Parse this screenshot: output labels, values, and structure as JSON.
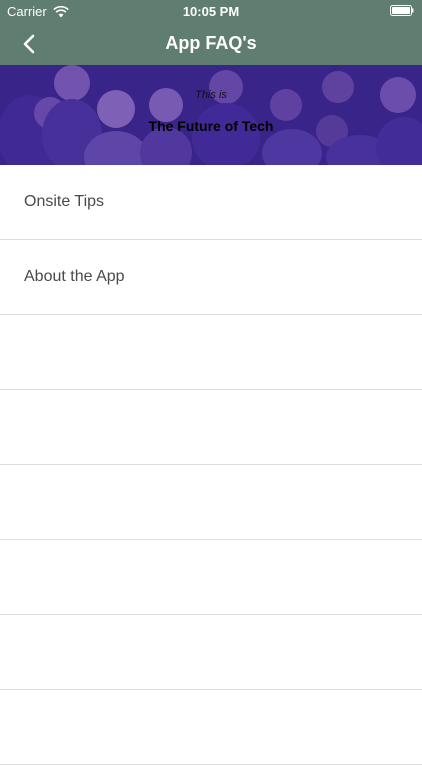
{
  "status_bar": {
    "carrier": "Carrier",
    "time": "10:05 PM"
  },
  "nav": {
    "title": "App FAQ's",
    "back_icon": "chevron-left-icon"
  },
  "banner": {
    "kicker": "This is",
    "headline": "The Future of Tech"
  },
  "list": {
    "items": [
      {
        "label": "Onsite Tips"
      },
      {
        "label": "About the App"
      },
      {
        "label": ""
      },
      {
        "label": ""
      },
      {
        "label": ""
      },
      {
        "label": ""
      },
      {
        "label": ""
      },
      {
        "label": ""
      }
    ]
  },
  "colors": {
    "nav_background": "#5f7e71",
    "banner_overlay": "#4628aa",
    "separator": "#dedede",
    "row_text": "#4a4a4a"
  }
}
